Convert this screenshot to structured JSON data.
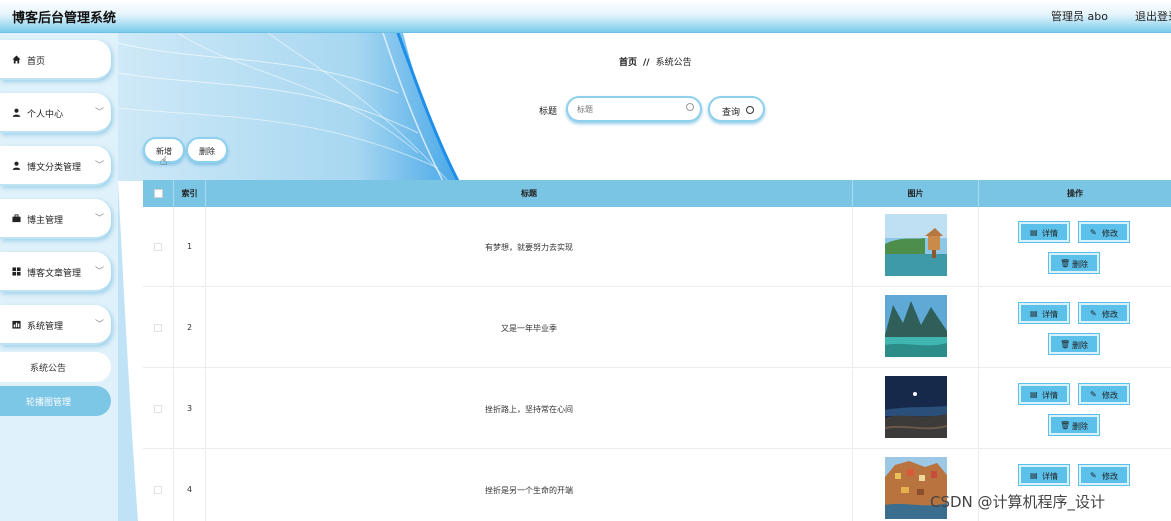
{
  "header": {
    "title": "博客后台管理系统",
    "user": "管理员 abo",
    "logout": "退出登录"
  },
  "sidebar": {
    "items": [
      {
        "label": "首页",
        "icon": "home-icon"
      },
      {
        "label": "个人中心",
        "icon": "user-icon"
      },
      {
        "label": "博文分类管理",
        "icon": "user-icon"
      },
      {
        "label": "博主管理",
        "icon": "briefcase-icon"
      },
      {
        "label": "博客文章管理",
        "icon": "grid-icon"
      },
      {
        "label": "系统管理",
        "icon": "chart-icon"
      }
    ],
    "submenu": [
      {
        "label": "系统公告",
        "active": false
      },
      {
        "label": "轮播图管理",
        "active": true
      }
    ]
  },
  "breadcrumb": {
    "home": "首页",
    "separator": "//",
    "current": "系统公告"
  },
  "search": {
    "label": "标题",
    "placeholder": "标题",
    "button": "查询"
  },
  "actions": {
    "add": "新增",
    "delete": "删除"
  },
  "table": {
    "headers": {
      "index": "索引",
      "title": "标题",
      "image": "图片",
      "ops": "操作"
    },
    "rows": [
      {
        "index": "1",
        "title": "有梦想，就要努力去实现",
        "image": "lake-pavilion"
      },
      {
        "index": "2",
        "title": "又是一年毕业季",
        "image": "mountain-river"
      },
      {
        "index": "3",
        "title": "挫折路上，坚持常在心间",
        "image": "night-sky-coast"
      },
      {
        "index": "4",
        "title": "挫折是另一个生命的开端",
        "image": "cliff-village"
      }
    ],
    "op_labels": {
      "detail": "详情",
      "edit": "修改",
      "delete": "删除"
    }
  },
  "watermark": "CSDN @计算机程序_设计",
  "colors": {
    "accent": "#7bc5e4",
    "button": "#5bc0ea",
    "sidebar_bg": "#dff1fa"
  }
}
